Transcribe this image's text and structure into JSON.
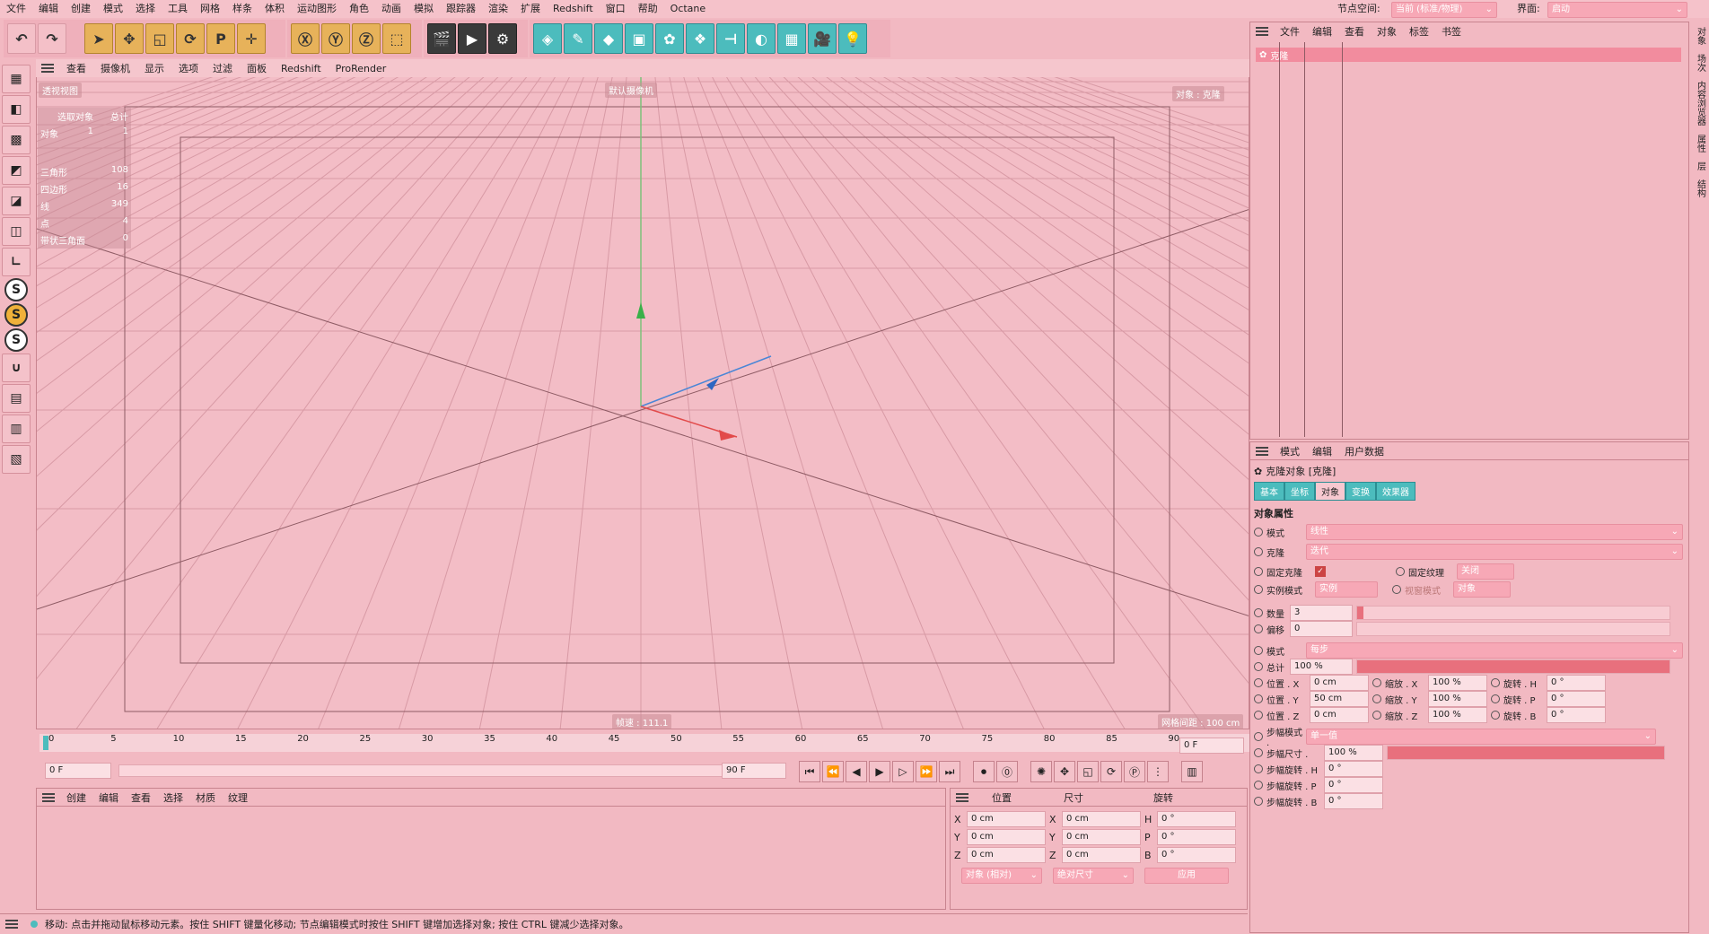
{
  "menu": [
    "文件",
    "编辑",
    "创建",
    "模式",
    "选择",
    "工具",
    "网格",
    "样条",
    "体积",
    "运动图形",
    "角色",
    "动画",
    "模拟",
    "跟踪器",
    "渲染",
    "扩展",
    "Redshift",
    "窗口",
    "帮助",
    "Octane"
  ],
  "node_space_label": "节点空间:",
  "node_space_value": "当前 (标准/物理)",
  "layout_label": "界面:",
  "layout_value": "启动",
  "viewport": {
    "menu": [
      "查看",
      "摄像机",
      "显示",
      "选项",
      "过滤",
      "面板",
      "Redshift",
      "ProRender"
    ],
    "view_name": "透视视图",
    "camera": "默认摄像机",
    "object_tag": "对象 : 克隆",
    "stats_header": [
      "选取对象",
      "总计"
    ],
    "stats_objects": [
      "对象",
      "1",
      "1"
    ],
    "stats": [
      [
        "三角形",
        "108"
      ],
      [
        "四边形",
        "16"
      ],
      [
        "线",
        "349"
      ],
      [
        "点",
        "4"
      ],
      [
        "带状三角面",
        "0"
      ]
    ],
    "speed": "帧速 : 111.1",
    "grid": "网格间距 : 100 cm"
  },
  "timeline": {
    "ticks": [
      "0",
      "5",
      "10",
      "15",
      "20",
      "25",
      "30",
      "35",
      "40",
      "45",
      "50",
      "55",
      "60",
      "65",
      "70",
      "75",
      "80",
      "85",
      "90"
    ],
    "current": "0 F",
    "start": "0 F",
    "end": "90 F",
    "end2": "90 F"
  },
  "materials": {
    "menu": [
      "创建",
      "编辑",
      "查看",
      "选择",
      "材质",
      "纹理"
    ]
  },
  "coords": {
    "headers": [
      "位置",
      "尺寸",
      "旋转"
    ],
    "rows": [
      [
        "X",
        "0 cm",
        "X",
        "0 cm",
        "H",
        "0 °"
      ],
      [
        "Y",
        "0 cm",
        "Y",
        "0 cm",
        "P",
        "0 °"
      ],
      [
        "Z",
        "0 cm",
        "Z",
        "0 cm",
        "B",
        "0 °"
      ]
    ],
    "mode1": "对象 (相对)",
    "mode2": "绝对尺寸",
    "apply": "应用"
  },
  "status": "移动: 点击并拖动鼠标移动元素。按住 SHIFT 键量化移动; 节点编辑模式时按住 SHIFT 键增加选择对象; 按住 CTRL 键减少选择对象。",
  "objects": {
    "menu": [
      "文件",
      "编辑",
      "查看",
      "对象",
      "标签",
      "书签"
    ],
    "item": "克隆"
  },
  "attributes": {
    "menu": [
      "模式",
      "编辑",
      "用户数据"
    ],
    "title": "克隆对象 [克隆]",
    "tabs": [
      "基本",
      "坐标",
      "对象",
      "变换",
      "效果器"
    ],
    "section": "对象属性",
    "mode_label": "模式",
    "mode_value": "线性",
    "clone_label": "克隆",
    "clone_value": "迭代",
    "fix_clone": "固定克隆",
    "fix_tex": "固定纹理",
    "fix_tex_val": "关闭",
    "inst_mode": "实例模式",
    "inst_val": "实例",
    "view_mode": "视窗模式",
    "view_val": "对象",
    "count_label": "数量",
    "count_value": "3",
    "offset_label": "偏移",
    "offset_value": "0",
    "mode2_label": "模式",
    "mode2_value": "每步",
    "total_label": "总计",
    "total_value": "100 %",
    "pos": [
      [
        "位置 . X",
        "0 cm",
        "缩放 . X",
        "100 %",
        "旋转 . H",
        "0 °"
      ],
      [
        "位置 . Y",
        "50 cm",
        "缩放 . Y",
        "100 %",
        "旋转 . P",
        "0 °"
      ],
      [
        "位置 . Z",
        "0 cm",
        "缩放 . Z",
        "100 %",
        "旋转 . B",
        "0 °"
      ]
    ],
    "step_mode": "步幅模式 .",
    "step_mode_val": "单一值",
    "step_size": "步幅尺寸 .",
    "step_size_val": "100 %",
    "step_rot": [
      [
        "步幅旋转 . H",
        "0 °"
      ],
      [
        "步幅旋转 . P",
        "0 °"
      ],
      [
        "步幅旋转 . B",
        "0 °"
      ]
    ]
  },
  "side_tabs": [
    "对象",
    "场次",
    "内容浏览器",
    "属性",
    "层",
    "结构"
  ]
}
